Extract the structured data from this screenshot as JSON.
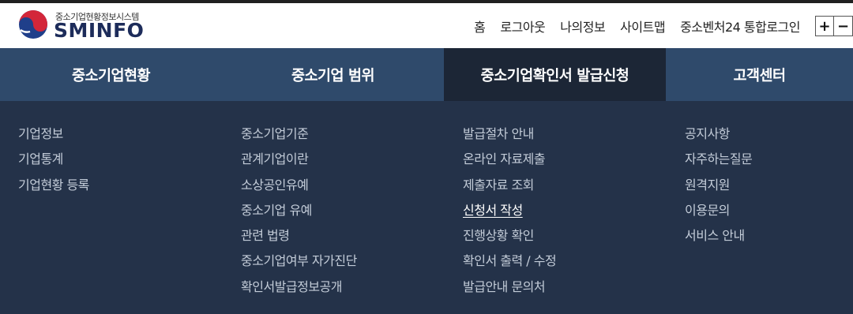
{
  "brand": {
    "subtitle": "중소기업현황정보시스템",
    "name": "SMINFO"
  },
  "util_nav": [
    "홈",
    "로그아웃",
    "나의정보",
    "사이트맵",
    "중소벤처24 통합로그인"
  ],
  "zoom": {
    "in": "+",
    "out": "−"
  },
  "gnb": [
    {
      "label": "중소기업현황",
      "active": false
    },
    {
      "label": "중소기업 범위",
      "active": false
    },
    {
      "label": "중소기업확인서 발급신청",
      "active": true
    },
    {
      "label": "고객센터",
      "active": false
    }
  ],
  "submenu": [
    [
      "기업정보",
      "기업통계",
      "기업현황 등록"
    ],
    [
      "중소기업기준",
      "관계기업이란",
      "소상공인유예",
      "중소기업 유예",
      "관련 법령",
      "중소기업여부 자가진단",
      "확인서발급정보공개"
    ],
    [
      "발급절차 안내",
      "온라인 자료제출",
      "제출자료 조회",
      "신청서 작성",
      "진행상황 확인",
      "확인서 출력 / 수정",
      "발급안내 문의처"
    ],
    [
      "공지사항",
      "자주하는질문",
      "원격지원",
      "이용문의",
      "서비스 안내"
    ]
  ],
  "active_submenu": "신청서 작성",
  "colors": {
    "gnb_bg": "#2f4a6b",
    "gnb_active_bg": "#1c2636",
    "mega_bg": "#243249",
    "brand_navy": "#1d2c5a"
  }
}
